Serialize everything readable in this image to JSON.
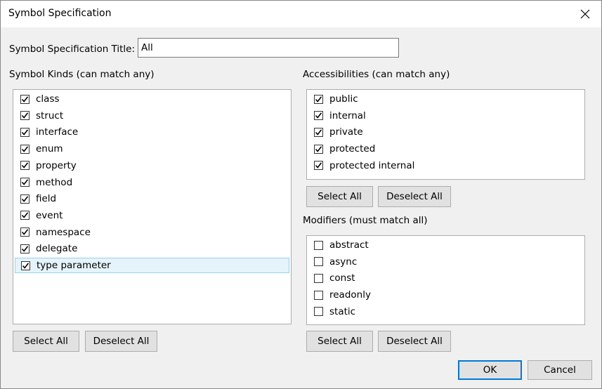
{
  "window": {
    "title": "Symbol Specification"
  },
  "spec_title": {
    "label": "Symbol Specification Title:",
    "value": "All"
  },
  "symbol_kinds": {
    "label": "Symbol Kinds (can match any)",
    "items": [
      {
        "label": "class",
        "checked": true
      },
      {
        "label": "struct",
        "checked": true
      },
      {
        "label": "interface",
        "checked": true
      },
      {
        "label": "enum",
        "checked": true
      },
      {
        "label": "property",
        "checked": true
      },
      {
        "label": "method",
        "checked": true
      },
      {
        "label": "field",
        "checked": true
      },
      {
        "label": "event",
        "checked": true
      },
      {
        "label": "namespace",
        "checked": true
      },
      {
        "label": "delegate",
        "checked": true
      },
      {
        "label": "type parameter",
        "checked": true,
        "selected": true
      }
    ],
    "select_all": "Select All",
    "deselect_all": "Deselect All"
  },
  "accessibilities": {
    "label": "Accessibilities (can match any)",
    "items": [
      {
        "label": "public",
        "checked": true
      },
      {
        "label": "internal",
        "checked": true
      },
      {
        "label": "private",
        "checked": true
      },
      {
        "label": "protected",
        "checked": true
      },
      {
        "label": "protected internal",
        "checked": true
      }
    ],
    "select_all": "Select All",
    "deselect_all": "Deselect All"
  },
  "modifiers": {
    "label": "Modifiers (must match all)",
    "items": [
      {
        "label": "abstract",
        "checked": false
      },
      {
        "label": "async",
        "checked": false
      },
      {
        "label": "const",
        "checked": false
      },
      {
        "label": "readonly",
        "checked": false
      },
      {
        "label": "static",
        "checked": false
      }
    ],
    "select_all": "Select All",
    "deselect_all": "Deselect All"
  },
  "footer": {
    "ok": "OK",
    "cancel": "Cancel"
  }
}
